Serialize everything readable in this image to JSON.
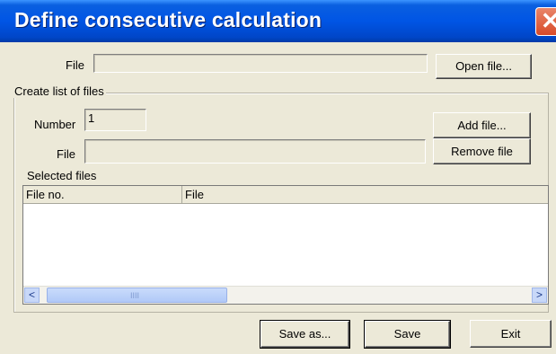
{
  "dialog": {
    "title": "Define consecutive calculation",
    "close_glyph": "✕"
  },
  "file_row": {
    "label": "File",
    "value": "",
    "open_button": "Open file..."
  },
  "create_list": {
    "group_label": "Create list of files",
    "number_label": "Number",
    "number_value": "1",
    "file_label": "File",
    "file_value": "",
    "add_button": "Add file...",
    "remove_button": "Remove file"
  },
  "selected": {
    "label": "Selected files",
    "columns": [
      "File no.",
      "File"
    ],
    "rows": [],
    "scroll_left": "<",
    "scroll_right": ">",
    "thumb_grip": "IIII"
  },
  "footer": {
    "save_as": "Save as...",
    "save": "Save",
    "exit": "Exit"
  },
  "colors": {
    "titlebar": "#0055e5",
    "dialog_bg": "#ece9d8",
    "close": "#d84a28"
  }
}
